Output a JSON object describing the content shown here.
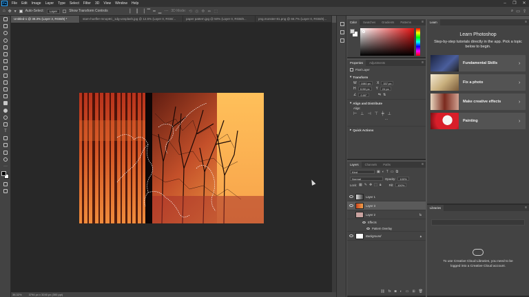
{
  "app": {
    "logo": "Ps"
  },
  "menu": [
    "File",
    "Edit",
    "Image",
    "Layer",
    "Type",
    "Select",
    "Filter",
    "3D",
    "View",
    "Window",
    "Help"
  ],
  "options": {
    "auto_select_label": "Auto-Select:",
    "auto_select_value": "Layer",
    "transform_controls_label": "Show Transform Controls",
    "mode_3d_label": "3D Mode:"
  },
  "tabs": [
    "Untitled-1 @ 38.3% (Layer 3, RGB/8) *",
    "stam-hoefler-mnop6C_1dg-unsplash.jpg @ 12.5% (Layer 0, RGB/...",
    "paper pattern.jpg @ 50% (Layer 0, RGB/8...",
    "png.monster-81.png @ 66.7% (Layer 0, RGB/8)..."
  ],
  "status": {
    "zoom": "38.32%",
    "doc_size": "3794 px x 3240 px (300 ppi)"
  },
  "color_panel": {
    "tabs": [
      "Color",
      "Swatches",
      "Gradients",
      "Patterns"
    ]
  },
  "properties_panel": {
    "tabs": [
      "Properties",
      "Adjustments"
    ],
    "layer_type": "Pixel Layer",
    "transform_title": "Transform",
    "w_label": "W",
    "w_value": "1080 px",
    "x_label": "X",
    "x_value": "337 px",
    "h_label": "H",
    "h_value": "1190 px",
    "y_label": "Y",
    "y_value": "24 px",
    "angle_value": "0.00°",
    "align_title": "Align and Distribute",
    "align_label": "Align:",
    "quick_actions_title": "Quick Actions"
  },
  "layers_panel": {
    "tabs": [
      "Layers",
      "Channels",
      "Paths"
    ],
    "filter_kind": "Kind",
    "blend_mode": "Normal",
    "opacity_label": "Opacity:",
    "opacity_value": "100%",
    "lock_label": "Lock:",
    "fill_label": "Fill:",
    "fill_value": "100%",
    "layers": [
      {
        "name": "Layer 1"
      },
      {
        "name": "Layer 3"
      },
      {
        "name": "Layer 2"
      },
      {
        "name": "Effects"
      },
      {
        "name": "Pattern Overlay"
      },
      {
        "name": "Background"
      }
    ]
  },
  "learn_panel": {
    "tab": "Learn",
    "title": "Learn Photoshop",
    "subtitle": "Step-by-step tutorials directly in the app. Pick a topic below to begin.",
    "topics": [
      "Fundamental Skills",
      "Fix a photo",
      "Make creative effects",
      "Painting"
    ]
  },
  "libraries_panel": {
    "tab": "Libraries",
    "message": "To use Creative Cloud Libraries, you need to be logged into a Creative Cloud account."
  },
  "colors": {
    "accent": "#31a8ff",
    "canvas_bg": "#282828",
    "panel_bg": "#434343",
    "menubar_bg": "#323232"
  }
}
